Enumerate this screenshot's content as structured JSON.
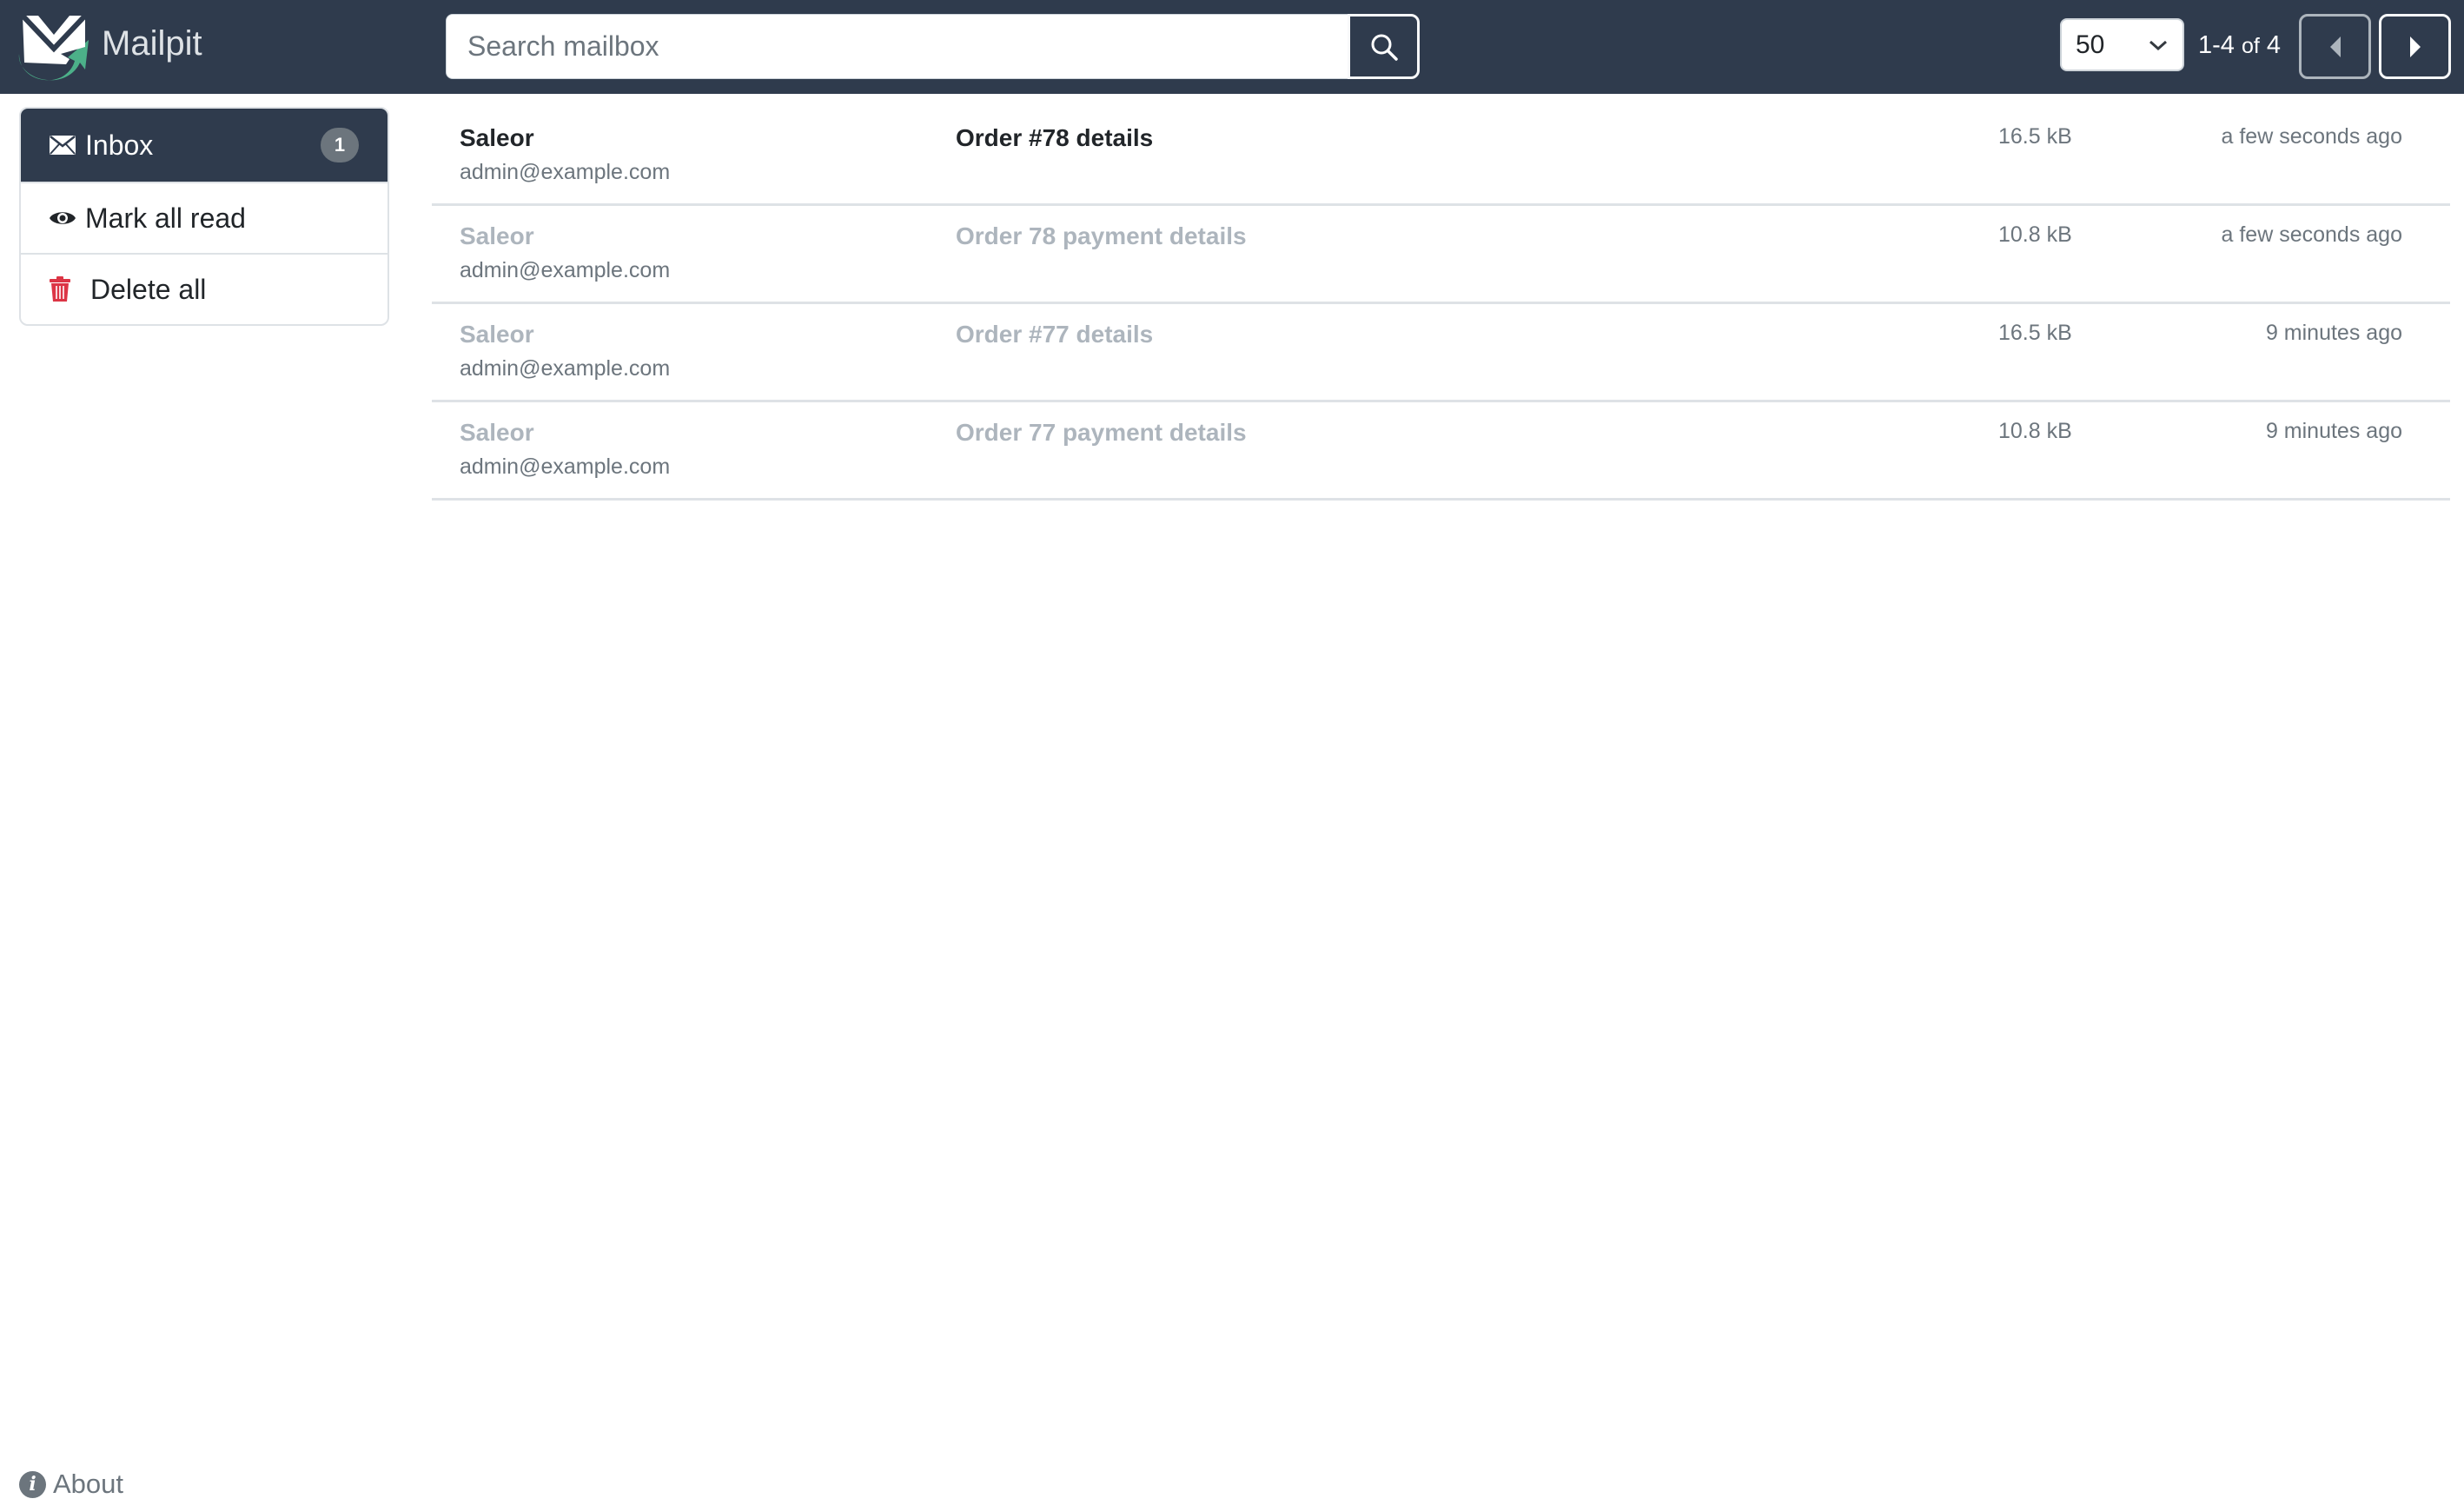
{
  "app": {
    "name": "Mailpit",
    "colors": {
      "header_bg": "#2f3b4d",
      "logo_green": "#4cb089",
      "delete_red": "#dc3545",
      "badge_gray": "#6c757d"
    }
  },
  "header": {
    "search": {
      "placeholder": "Search mailbox",
      "value": "",
      "button_icon": "search-icon"
    },
    "per_page": {
      "selected": "50",
      "icon": "chevron-down-icon"
    },
    "pagination": {
      "range": "1-4",
      "of_label": "of",
      "total": "4"
    },
    "prev_icon": "caret-left-icon",
    "next_icon": "caret-right-icon"
  },
  "sidebar": {
    "items": [
      {
        "label": "Inbox",
        "icon": "envelope-icon",
        "badge": "1",
        "active": true
      },
      {
        "label": "Mark all read",
        "icon": "eye-icon"
      },
      {
        "label": "Delete all",
        "icon": "trash-icon"
      }
    ],
    "about_label": "About"
  },
  "messages": [
    {
      "from_name": "Saleor",
      "from_email": "admin@example.com",
      "subject": "Order #78 details",
      "size": "16.5 kB",
      "date": "a few seconds ago",
      "read": false
    },
    {
      "from_name": "Saleor",
      "from_email": "admin@example.com",
      "subject": "Order 78 payment details",
      "size": "10.8 kB",
      "date": "a few seconds ago",
      "read": true
    },
    {
      "from_name": "Saleor",
      "from_email": "admin@example.com",
      "subject": "Order #77 details",
      "size": "16.5 kB",
      "date": "9 minutes ago",
      "read": true
    },
    {
      "from_name": "Saleor",
      "from_email": "admin@example.com",
      "subject": "Order 77 payment details",
      "size": "10.8 kB",
      "date": "9 minutes ago",
      "read": true
    }
  ]
}
